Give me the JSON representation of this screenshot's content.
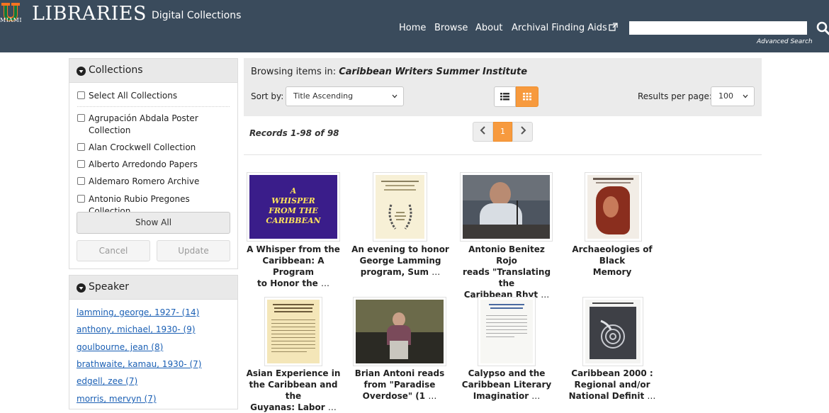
{
  "header": {
    "logo_miami": "MIAMI",
    "logo_libraries": "LIBRARIES",
    "logo_subtitle": "Digital Collections",
    "nav": [
      "Home",
      "Browse",
      "About",
      "Archival Finding Aids"
    ],
    "search_placeholder": "",
    "advanced_search": "Advanced Search",
    "colors": {
      "bar": "#3a4b5c",
      "accent_u_green": "#0a7a3c",
      "accent_u_orange": "#f47321"
    }
  },
  "collections": {
    "title": "Collections",
    "select_all": "Select All Collections",
    "items": [
      "Agrupación Abdala Poster Collection",
      "Alan Crockwell Collection",
      "Alberto Arredondo Papers",
      "Aldemaro Romero Archive",
      "Antonio Rubio Pregones Collection"
    ],
    "show_all": "Show All",
    "cancel": "Cancel",
    "update": "Update"
  },
  "speaker": {
    "title": "Speaker",
    "items": [
      "lamming, george, 1927- (14)",
      "anthony, michael, 1930- (9)",
      "goulbourne, jean (8)",
      "brathwaite, kamau, 1930- (7)",
      "edgell, zee (7)",
      "morris, mervyn (7)"
    ]
  },
  "toolbar": {
    "browsing_label": "Browsing items in:",
    "collection_name": "Caribbean Writers Summer Institute",
    "sort_label": "Sort by:",
    "sort_value": "Title Ascending",
    "rpp_label": "Results per page:",
    "rpp_value": "100",
    "view_list_icon": "list-view-icon",
    "view_grid_icon": "grid-view-icon",
    "accent": "#f79a3e"
  },
  "results": {
    "records": "Records 1-98 of 98",
    "current_page": "1",
    "prev_icon": "chevron-left-icon",
    "next_icon": "chevron-right-icon"
  },
  "items": [
    {
      "line1": "A Whisper from the",
      "line2": "Caribbean: A Program",
      "line3": "to Honor the",
      "ellipsis": "…",
      "thumb_text": [
        "A",
        "WHISPER",
        "FROM THE",
        "CARIBBEAN"
      ]
    },
    {
      "line1": "An evening to honor",
      "line2": "George Lamming",
      "line3": "program, Sum",
      "ellipsis": "…"
    },
    {
      "line1": "Antonio Benitez Rojo",
      "line2": "reads \"Translating the",
      "line3": "Caribbean Rhyt",
      "ellipsis": "…"
    },
    {
      "line1": "Archaeologies of Black",
      "line2": "Memory",
      "line3": "",
      "ellipsis": ""
    },
    {
      "line1": "Asian Experience in",
      "line2": "the Caribbean and the",
      "line3": "Guyanas: Labor",
      "ellipsis": "…"
    },
    {
      "line1": "Brian Antoni reads",
      "line2": "from \"Paradise",
      "line3": "Overdose\" (1",
      "ellipsis": "…"
    },
    {
      "line1": "Calypso and the",
      "line2": "Caribbean Literary",
      "line3": "Imaginatior",
      "ellipsis": "…"
    },
    {
      "line1": "Caribbean 2000 :",
      "line2": "Regional and/or",
      "line3": "National Definit",
      "ellipsis": "…"
    }
  ]
}
